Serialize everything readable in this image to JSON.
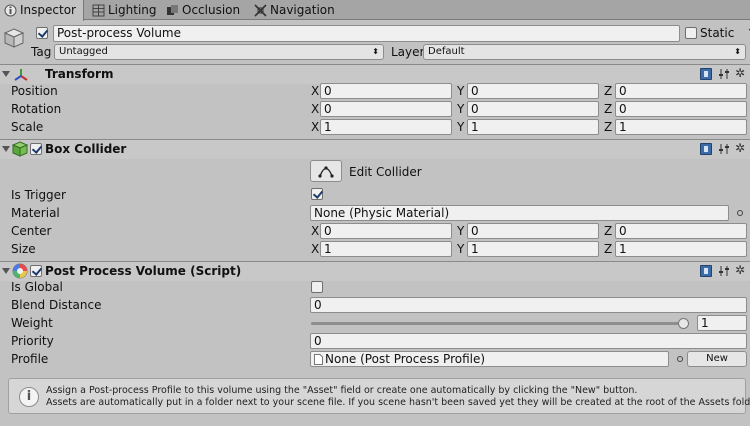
{
  "tabs": [
    {
      "label": "Inspector",
      "icon": "inspector-icon",
      "active": true
    },
    {
      "label": "Lighting",
      "icon": "lighting-icon"
    },
    {
      "label": "Occlusion",
      "icon": "occlusion-icon"
    },
    {
      "label": "Navigation",
      "icon": "navigation-icon"
    }
  ],
  "object": {
    "name": "Post-process Volume",
    "active": true,
    "static_label": "Static",
    "tag_label": "Tag",
    "tag_value": "Untagged",
    "layer_label": "Layer",
    "layer_value": "Default"
  },
  "transform": {
    "title": "Transform",
    "rows": [
      {
        "label": "Position",
        "x": "0",
        "y": "0",
        "z": "0"
      },
      {
        "label": "Rotation",
        "x": "0",
        "y": "0",
        "z": "0"
      },
      {
        "label": "Scale",
        "x": "1",
        "y": "1",
        "z": "1"
      }
    ]
  },
  "box_collider": {
    "title": "Box Collider",
    "enabled": true,
    "edit_collider_label": "Edit Collider",
    "is_trigger_label": "Is Trigger",
    "is_trigger": true,
    "material_label": "Material",
    "material_value": "None (Physic Material)",
    "rows": [
      {
        "label": "Center",
        "x": "0",
        "y": "0",
        "z": "0"
      },
      {
        "label": "Size",
        "x": "1",
        "y": "1",
        "z": "1"
      }
    ]
  },
  "post_process_volume": {
    "title": "Post Process Volume (Script)",
    "enabled": true,
    "is_global_label": "Is Global",
    "is_global": false,
    "blend_distance_label": "Blend Distance",
    "blend_distance": "0",
    "weight_label": "Weight",
    "weight": "1",
    "weight_fraction": 1.0,
    "priority_label": "Priority",
    "priority": "0",
    "profile_label": "Profile",
    "profile_value": "None (Post Process Profile)",
    "new_button": "New"
  },
  "help": {
    "line1": "Assign a Post-process Profile to this volume using the \"Asset\" field or create one automatically by clicking the \"New\" button.",
    "line2": "Assets are automatically put in a folder next to your scene file. If you scene hasn't been saved yet they will be created at the root of the Assets folder."
  },
  "axes": {
    "x": "X",
    "y": "Y",
    "z": "Z"
  },
  "colors": {
    "panel": "#c2c2c2",
    "tabbar": "#a5a5a5",
    "accent": "#3c6ca8"
  }
}
